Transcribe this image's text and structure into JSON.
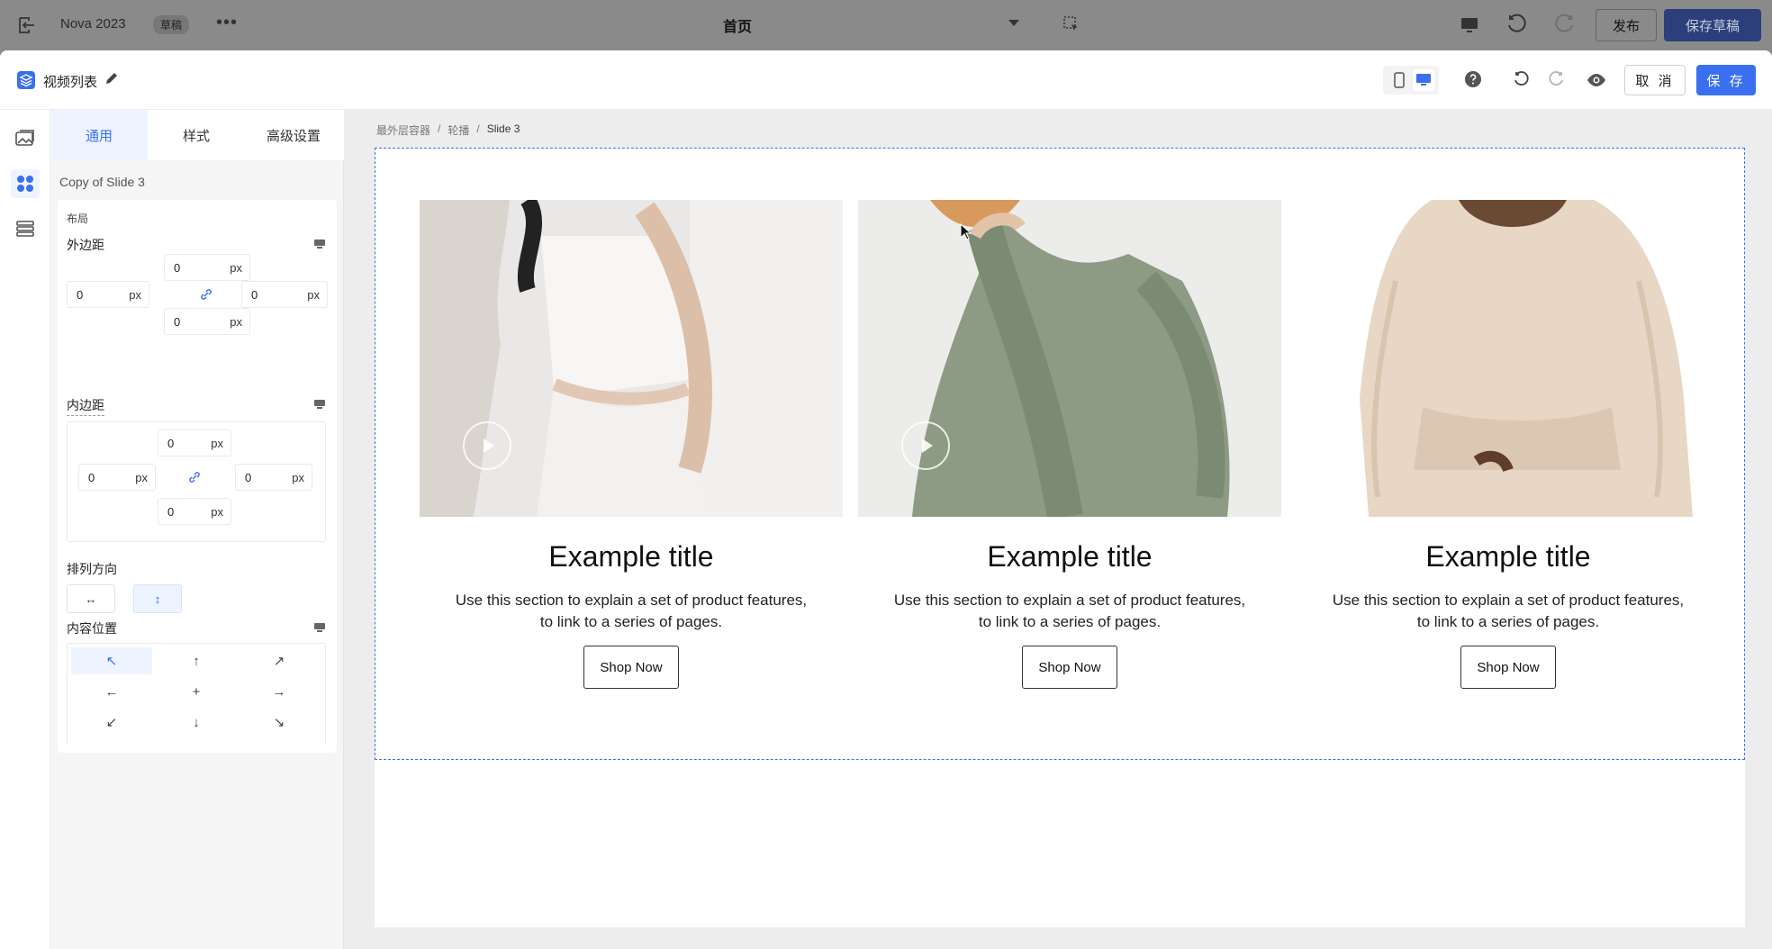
{
  "topbar": {
    "project_name": "Nova 2023",
    "draft_badge": "草稿",
    "more": "•••",
    "page_select": "首页",
    "publish": "发布",
    "save_draft": "保存草稿"
  },
  "modal": {
    "title": "视频列表",
    "cancel": "取 消",
    "save": "保 存"
  },
  "panel": {
    "tabs": [
      "通用",
      "样式",
      "高级设置"
    ],
    "active_tab": 0,
    "element_name": "Copy of Slide 3",
    "layout_label": "布局",
    "margin": {
      "label": "外边距",
      "top": "0",
      "right": "0",
      "bottom": "0",
      "left": "0",
      "unit": "px"
    },
    "padding": {
      "label": "内边距",
      "top": "0",
      "right": "0",
      "bottom": "0",
      "left": "0",
      "unit": "px"
    },
    "direction": {
      "label": "排列方向",
      "horizontal": "↔",
      "vertical": "↕",
      "selected": "vertical"
    },
    "content_position": {
      "label": "内容位置",
      "cells": [
        "↖",
        "↑",
        "↗",
        "←",
        "+",
        "→",
        "↙",
        "↓",
        "↘"
      ],
      "selected": 0
    }
  },
  "canvas": {
    "breadcrumb": [
      "最外层容器",
      "轮播",
      "Slide 3"
    ],
    "slides": [
      {
        "title": "Example title",
        "desc_line1": "Use this section to explain a set of product features,",
        "desc_line2": "to link to a series of pages.",
        "button": "Shop Now"
      },
      {
        "title": "Example title",
        "desc_line1": "Use this section to explain a set of product features,",
        "desc_line2": "to link to a series of pages.",
        "button": "Shop Now"
      },
      {
        "title": "Example title",
        "desc_line1": "Use this section to explain a set of product features,",
        "desc_line2": "to link to a series of pages.",
        "button": "Shop Now"
      }
    ]
  },
  "colors": {
    "accent": "#3a6ff0",
    "selection": "#3a6ff0"
  }
}
